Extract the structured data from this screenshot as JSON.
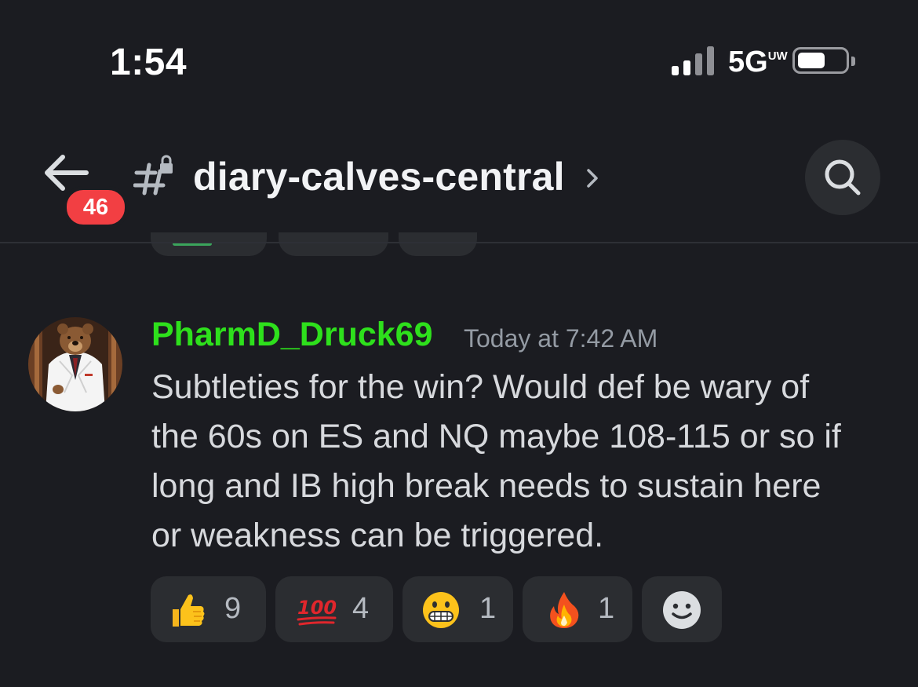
{
  "status_bar": {
    "time": "1:54",
    "network": "5G",
    "network_sup": "UW",
    "signal_icon": "cellular-signal-icon",
    "battery_icon": "battery-icon"
  },
  "header": {
    "unread_count": "46",
    "channel_name": "diary-calves-central",
    "back_icon": "arrow-left-icon",
    "channel_icon": "hashtag-lock-icon",
    "chevron_icon": "chevron-right-icon",
    "search_icon": "search-icon"
  },
  "message": {
    "username": "PharmD_Druck69",
    "timestamp": "Today at 7:42 AM",
    "body_lines": [
      "Subtleties for the win? Would def be wary of",
      "the 60s on ES and NQ maybe 108-115 or so if",
      "long and IB high break needs to sustain here",
      "or weakness can be triggered."
    ],
    "username_color": "#2ee01c"
  },
  "reactions": [
    {
      "emoji": "thumbs-up-icon",
      "count": "9"
    },
    {
      "emoji": "hundred-points-icon",
      "count": "4"
    },
    {
      "emoji": "grimacing-face-icon",
      "count": "1"
    },
    {
      "emoji": "fire-icon",
      "count": "1"
    }
  ],
  "add_reaction_icon": "add-reaction-smiley-icon",
  "colors": {
    "background": "#1b1c21",
    "chip": "#2b2d31",
    "badge": "#f23f43",
    "muted_text": "#949ba4"
  }
}
